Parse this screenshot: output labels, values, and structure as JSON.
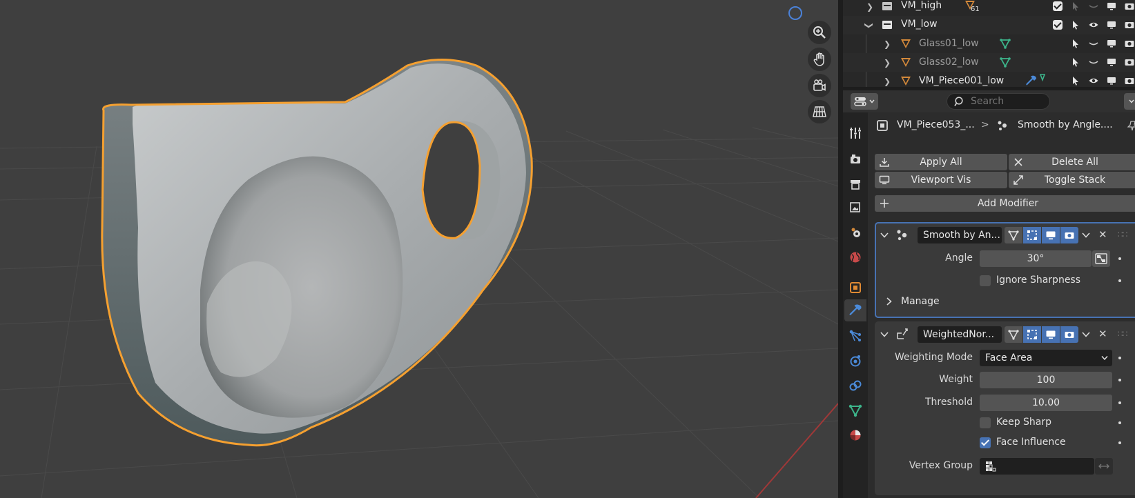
{
  "outliner": {
    "rows": [
      {
        "name": "VM_high",
        "badge": "61",
        "dim": false
      },
      {
        "name": "VM_low",
        "dim": false
      },
      {
        "name": "Glass01_low",
        "dim": true
      },
      {
        "name": "Glass02_low",
        "dim": true
      },
      {
        "name": "VM_Piece001_low",
        "dim": false
      }
    ]
  },
  "properties": {
    "search_placeholder": "Search",
    "breadcrumb": {
      "object": "VM_Piece053_...",
      "separator": ">",
      "modifier": "Smooth by Angle...."
    },
    "buttons": {
      "apply_all": "Apply All",
      "delete_all": "Delete All",
      "viewport_vis": "Viewport Vis",
      "toggle_stack": "Toggle Stack",
      "add_modifier": "Add Modifier"
    },
    "modifier1": {
      "name": "Smooth by An...",
      "angle_label": "Angle",
      "angle_value": "30°",
      "ignore_sharpness_label": "Ignore Sharpness",
      "manage_label": "Manage"
    },
    "modifier2": {
      "name": "WeightedNor...",
      "weighting_mode_label": "Weighting Mode",
      "weighting_mode_value": "Face Area",
      "weight_label": "Weight",
      "weight_value": "100",
      "threshold_label": "Threshold",
      "threshold_value": "10.00",
      "keep_sharp_label": "Keep Sharp",
      "face_influence_label": "Face Influence",
      "vertex_group_label": "Vertex Group"
    }
  },
  "colors": {
    "selection_outline": "#f5a030",
    "accent_blue": "#4772b3",
    "mesh_green": "#3cb48a",
    "object_orange": "#d4893a"
  }
}
